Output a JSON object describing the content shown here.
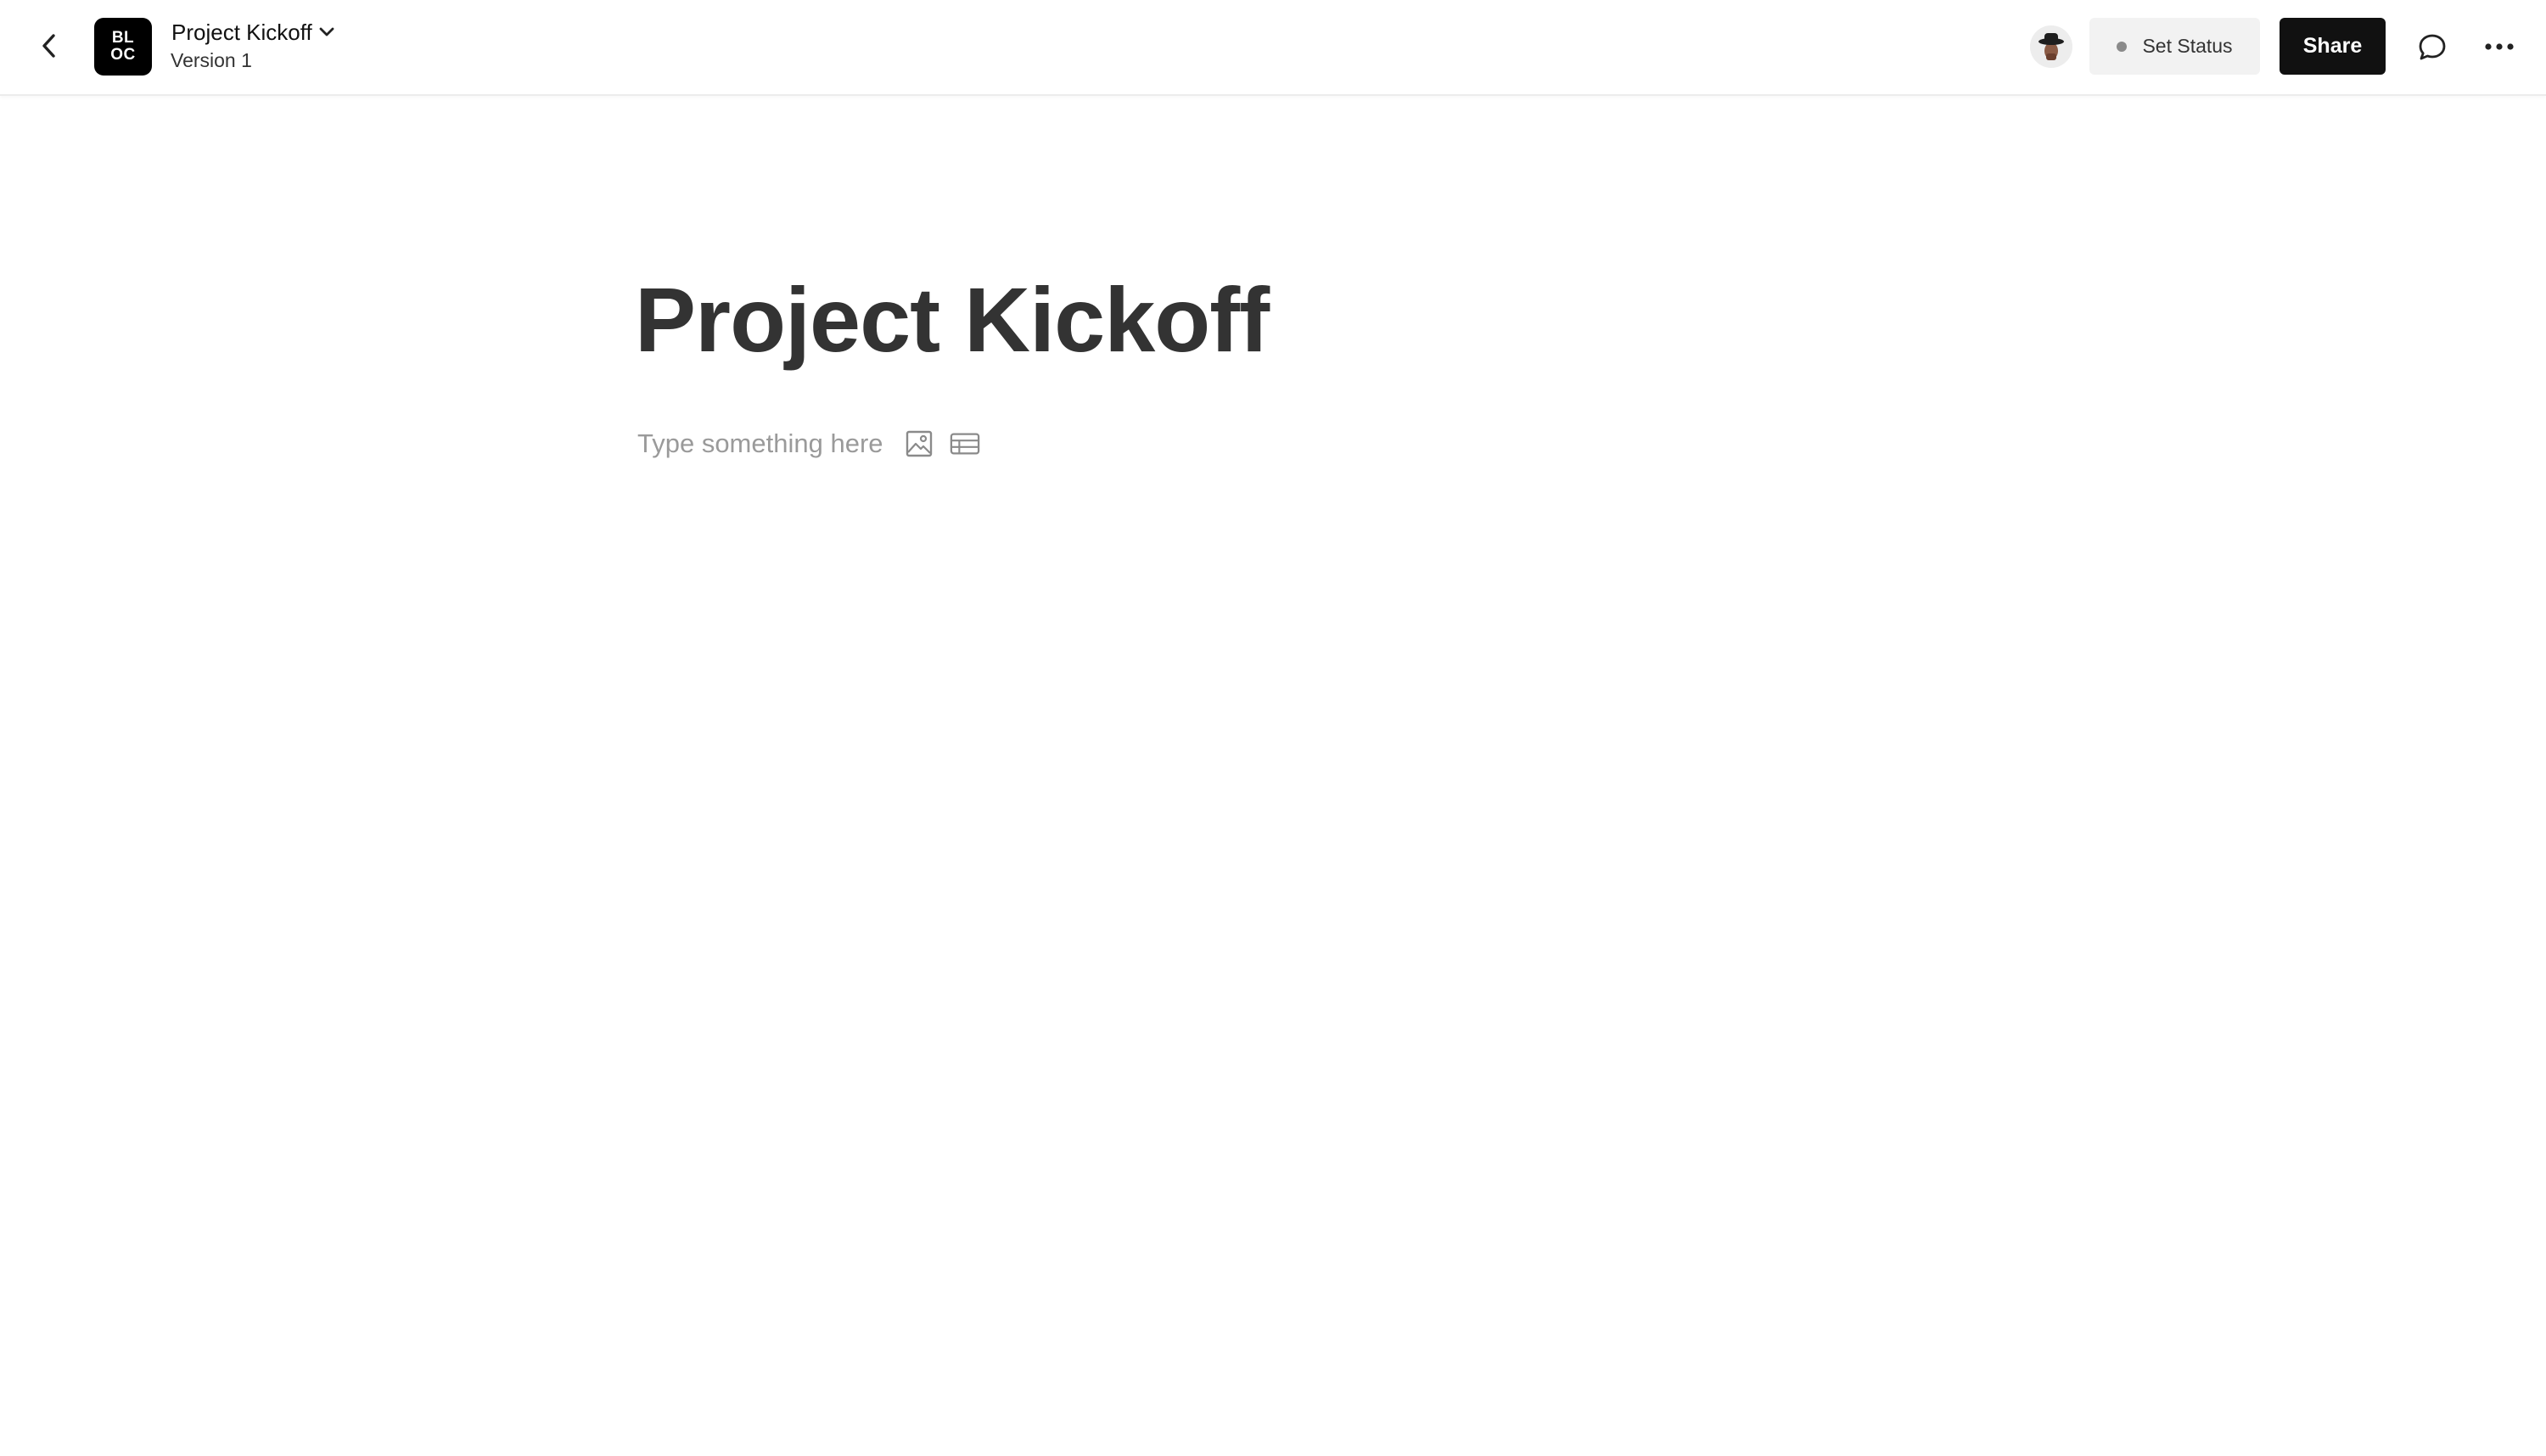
{
  "header": {
    "logo_line1": "BL",
    "logo_line2": "OC",
    "doc_title": "Project Kickoff",
    "doc_version": "Version 1",
    "status_label": "Set Status",
    "share_label": "Share"
  },
  "icons": {
    "back": "chevron-left-icon",
    "title_dropdown": "chevron-down-icon",
    "comment": "comment-bubble-icon",
    "more": "more-horizontal-icon",
    "insert_image": "image-icon",
    "insert_table": "table-icon"
  },
  "main": {
    "title": "Project Kickoff",
    "placeholder": "Type something here"
  },
  "colors": {
    "primary_button": "#111111",
    "status_dot": "#8a8a8a",
    "title_text": "#333333",
    "placeholder_text": "#9a9a9a"
  }
}
